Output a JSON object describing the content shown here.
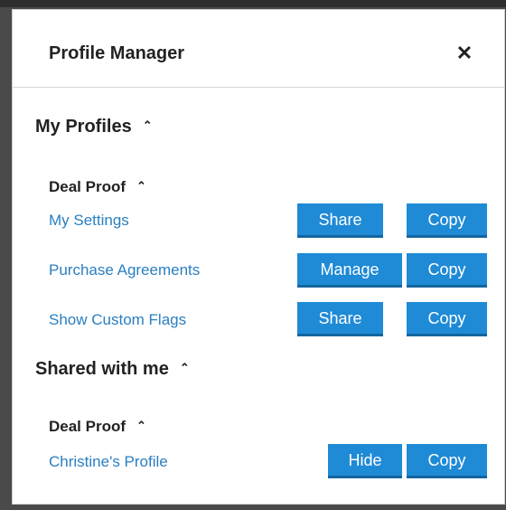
{
  "dialog": {
    "title": "Profile Manager",
    "close_icon": "close-icon",
    "close_glyph": "✕"
  },
  "chevron_glyph": "⌃",
  "my_profiles": {
    "heading": "My Profiles",
    "groups": [
      {
        "name": "Deal Proof",
        "items": [
          {
            "label": "My Settings",
            "primary_action": "Share",
            "secondary_action": "Copy"
          },
          {
            "label": "Purchase Agreements",
            "primary_action": "Manage",
            "secondary_action": "Copy"
          },
          {
            "label": "Show Custom Flags",
            "primary_action": "Share",
            "secondary_action": "Copy"
          }
        ]
      }
    ]
  },
  "shared_with_me": {
    "heading": "Shared with me",
    "groups": [
      {
        "name": "Deal Proof",
        "items": [
          {
            "label": "Christine's Profile",
            "primary_action": "Hide",
            "secondary_action": "Copy"
          }
        ]
      }
    ]
  },
  "colors": {
    "button": "#1f8ad6",
    "button_shadow": "#14659f",
    "link": "#2a7fc1"
  }
}
